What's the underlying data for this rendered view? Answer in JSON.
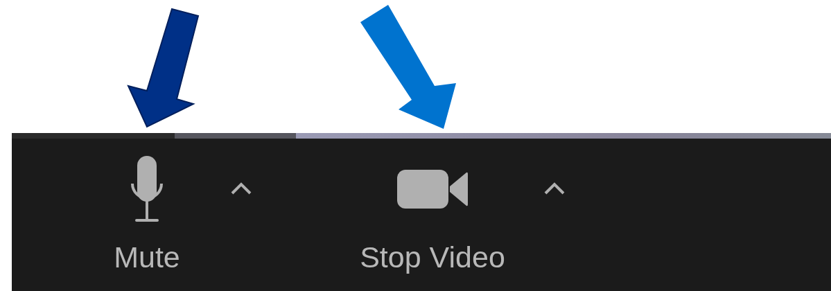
{
  "toolbar": {
    "buttons": [
      {
        "label": "Mute",
        "kind": "mic"
      },
      {
        "label": "Stop Video",
        "kind": "camera"
      }
    ]
  }
}
